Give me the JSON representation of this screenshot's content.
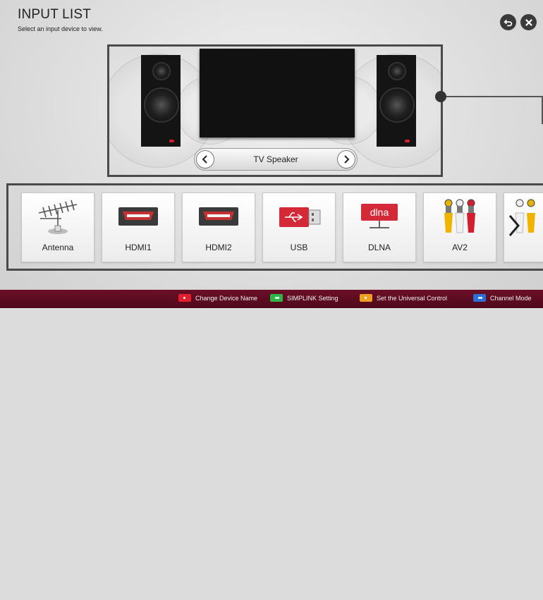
{
  "header": {
    "title": "INPUT LIST",
    "subtitle": "Select an input device to view."
  },
  "speaker_panel": {
    "selected_label": "TV Speaker"
  },
  "inputs": [
    {
      "label": "Antenna",
      "icon": "antenna-icon"
    },
    {
      "label": "HDMI1",
      "icon": "hdmi-icon"
    },
    {
      "label": "HDMI2",
      "icon": "hdmi-icon"
    },
    {
      "label": "USB",
      "icon": "usb-icon"
    },
    {
      "label": "DLNA",
      "icon": "dlna-icon",
      "icon_text": "dlna"
    },
    {
      "label": "AV2",
      "icon": "rca-cable-icon"
    },
    {
      "label": "",
      "icon": "component-cable-icon"
    }
  ],
  "footer": {
    "items": [
      {
        "label": "Change Device Name",
        "color": "#e0202e"
      },
      {
        "label": "SIMPLINK Setting",
        "color": "#2fb44a"
      },
      {
        "label": "Set the Universal Control",
        "color": "#f0a020"
      },
      {
        "label": "Channel Mode",
        "color": "#2a6fd8"
      }
    ]
  }
}
